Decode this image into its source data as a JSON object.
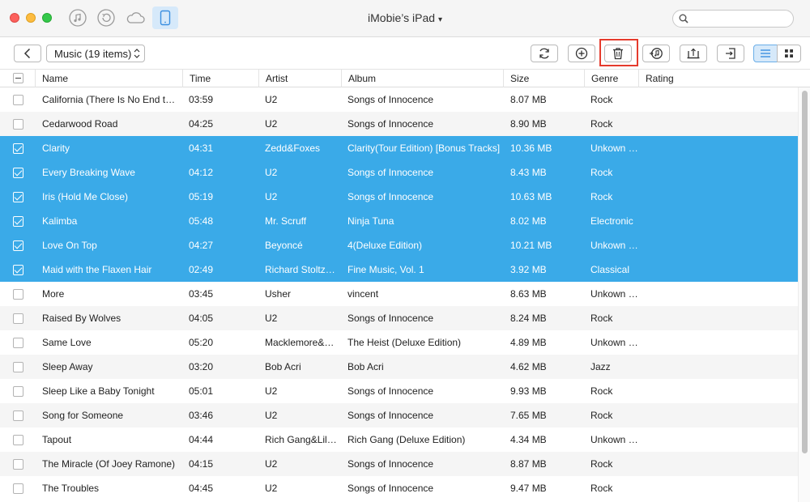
{
  "window": {
    "title": "iMobie’s iPad",
    "search_placeholder": ""
  },
  "toolbar": {
    "category": "Music (19 items)"
  },
  "columns": {
    "name": "Name",
    "time": "Time",
    "artist": "Artist",
    "album": "Album",
    "size": "Size",
    "genre": "Genre",
    "rating": "Rating"
  },
  "rows": [
    {
      "name": "California (There Is No End to Love)",
      "time": "03:59",
      "artist": "U2",
      "album": "Songs of Innocence",
      "size": "8.07 MB",
      "genre": "Rock",
      "selected": false
    },
    {
      "name": "Cedarwood Road",
      "time": "04:25",
      "artist": "U2",
      "album": "Songs of Innocence",
      "size": "8.90 MB",
      "genre": "Rock",
      "selected": false
    },
    {
      "name": "Clarity",
      "time": "04:31",
      "artist": "Zedd&Foxes",
      "album": "Clarity(Tour Edition) [Bonus Tracks]",
      "size": "10.36 MB",
      "genre": "Unkown Genre",
      "selected": true
    },
    {
      "name": "Every Breaking Wave",
      "time": "04:12",
      "artist": "U2",
      "album": "Songs of Innocence",
      "size": "8.43 MB",
      "genre": "Rock",
      "selected": true
    },
    {
      "name": "Iris (Hold Me Close)",
      "time": "05:19",
      "artist": "U2",
      "album": "Songs of Innocence",
      "size": "10.63 MB",
      "genre": "Rock",
      "selected": true
    },
    {
      "name": "Kalimba",
      "time": "05:48",
      "artist": "Mr. Scruff",
      "album": "Ninja Tuna",
      "size": "8.02 MB",
      "genre": "Electronic",
      "selected": true
    },
    {
      "name": "Love On Top",
      "time": "04:27",
      "artist": "Beyoncé",
      "album": "4(Deluxe Edition)",
      "size": "10.21 MB",
      "genre": "Unkown Genre",
      "selected": true
    },
    {
      "name": "Maid with the Flaxen Hair",
      "time": "02:49",
      "artist": "Richard Stoltzman",
      "album": "Fine Music, Vol. 1",
      "size": "3.92 MB",
      "genre": "Classical",
      "selected": true
    },
    {
      "name": "More",
      "time": "03:45",
      "artist": "Usher",
      "album": "vincent",
      "size": "8.63 MB",
      "genre": "Unkown Genre",
      "selected": false
    },
    {
      "name": "Raised By Wolves",
      "time": "04:05",
      "artist": "U2",
      "album": "Songs of Innocence",
      "size": "8.24 MB",
      "genre": "Rock",
      "selected": false
    },
    {
      "name": "Same Love",
      "time": "05:20",
      "artist": "Macklemore&Ryan Lewis",
      "album": "The Heist (Deluxe Edition)",
      "size": "4.89 MB",
      "genre": "Unkown Genre",
      "selected": false
    },
    {
      "name": "Sleep Away",
      "time": "03:20",
      "artist": "Bob Acri",
      "album": "Bob Acri",
      "size": "4.62 MB",
      "genre": "Jazz",
      "selected": false
    },
    {
      "name": "Sleep Like a Baby Tonight",
      "time": "05:01",
      "artist": "U2",
      "album": "Songs of Innocence",
      "size": "9.93 MB",
      "genre": "Rock",
      "selected": false
    },
    {
      "name": "Song for Someone",
      "time": "03:46",
      "artist": "U2",
      "album": "Songs of Innocence",
      "size": "7.65 MB",
      "genre": "Rock",
      "selected": false
    },
    {
      "name": "Tapout",
      "time": "04:44",
      "artist": "Rich Gang&Lil Wayne",
      "album": "Rich Gang (Deluxe Edition)",
      "size": "4.34 MB",
      "genre": "Unkown Genre",
      "selected": false
    },
    {
      "name": "The Miracle (Of Joey Ramone)",
      "time": "04:15",
      "artist": "U2",
      "album": "Songs of Innocence",
      "size": "8.87 MB",
      "genre": "Rock",
      "selected": false
    },
    {
      "name": "The Troubles",
      "time": "04:45",
      "artist": "U2",
      "album": "Songs of Innocence",
      "size": "9.47 MB",
      "genre": "Rock",
      "selected": false
    }
  ],
  "colors": {
    "selection": "#3aaae8",
    "accent": "#3b8fe0",
    "highlight_border": "#e53b2d"
  },
  "icons": {
    "titlebar": [
      "music-note-icon",
      "restore-icon",
      "cloud-icon",
      "ipad-icon"
    ],
    "toolbar": [
      "back-icon",
      "refresh-icon",
      "add-icon",
      "delete-icon",
      "to-itunes-icon",
      "to-computer-icon",
      "import-icon",
      "list-view-icon",
      "grid-view-icon"
    ]
  }
}
